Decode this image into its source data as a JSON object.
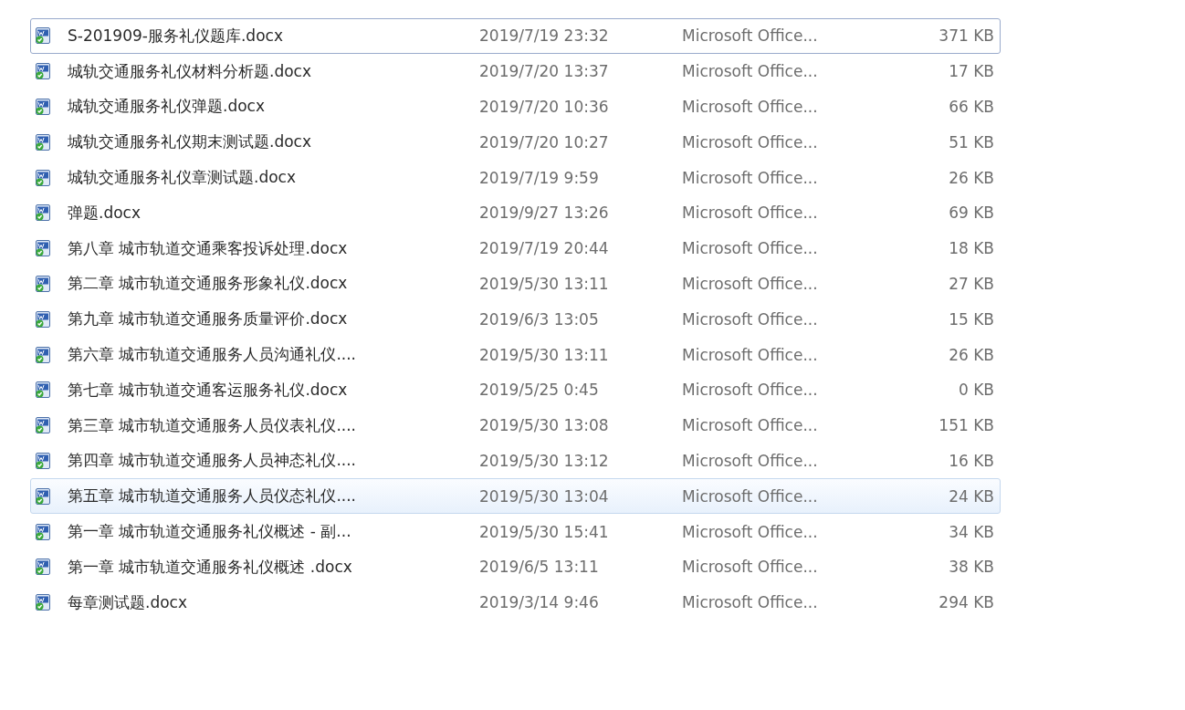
{
  "files": [
    {
      "name": "S-201909-服务礼仪题库.docx",
      "modified": "2019/7/19 23:32",
      "type": "Microsoft Office...",
      "size": "371 KB",
      "focused": true,
      "hovered": false
    },
    {
      "name": "城轨交通服务礼仪材料分析题.docx",
      "modified": "2019/7/20 13:37",
      "type": "Microsoft Office...",
      "size": "17 KB",
      "focused": false,
      "hovered": false
    },
    {
      "name": "城轨交通服务礼仪弹题.docx",
      "modified": "2019/7/20 10:36",
      "type": "Microsoft Office...",
      "size": "66 KB",
      "focused": false,
      "hovered": false
    },
    {
      "name": "城轨交通服务礼仪期末测试题.docx",
      "modified": "2019/7/20 10:27",
      "type": "Microsoft Office...",
      "size": "51 KB",
      "focused": false,
      "hovered": false
    },
    {
      "name": "城轨交通服务礼仪章测试题.docx",
      "modified": "2019/7/19 9:59",
      "type": "Microsoft Office...",
      "size": "26 KB",
      "focused": false,
      "hovered": false
    },
    {
      "name": "弹题.docx",
      "modified": "2019/9/27 13:26",
      "type": "Microsoft Office...",
      "size": "69 KB",
      "focused": false,
      "hovered": false
    },
    {
      "name": "第八章 城市轨道交通乘客投诉处理.docx",
      "modified": "2019/7/19 20:44",
      "type": "Microsoft Office...",
      "size": "18 KB",
      "focused": false,
      "hovered": false
    },
    {
      "name": "第二章 城市轨道交通服务形象礼仪.docx",
      "modified": "2019/5/30 13:11",
      "type": "Microsoft Office...",
      "size": "27 KB",
      "focused": false,
      "hovered": false
    },
    {
      "name": "第九章 城市轨道交通服务质量评价.docx",
      "modified": "2019/6/3 13:05",
      "type": "Microsoft Office...",
      "size": "15 KB",
      "focused": false,
      "hovered": false
    },
    {
      "name": "第六章 城市轨道交通服务人员沟通礼仪....",
      "modified": "2019/5/30 13:11",
      "type": "Microsoft Office...",
      "size": "26 KB",
      "focused": false,
      "hovered": false
    },
    {
      "name": "第七章 城市轨道交通客运服务礼仪.docx",
      "modified": "2019/5/25 0:45",
      "type": "Microsoft Office...",
      "size": "0 KB",
      "focused": false,
      "hovered": false
    },
    {
      "name": "第三章 城市轨道交通服务人员仪表礼仪....",
      "modified": "2019/5/30 13:08",
      "type": "Microsoft Office...",
      "size": "151 KB",
      "focused": false,
      "hovered": false
    },
    {
      "name": "第四章 城市轨道交通服务人员神态礼仪....",
      "modified": "2019/5/30 13:12",
      "type": "Microsoft Office...",
      "size": "16 KB",
      "focused": false,
      "hovered": false
    },
    {
      "name": "第五章 城市轨道交通服务人员仪态礼仪....",
      "modified": "2019/5/30 13:04",
      "type": "Microsoft Office...",
      "size": "24 KB",
      "focused": false,
      "hovered": true
    },
    {
      "name": "第一章 城市轨道交通服务礼仪概述  - 副...",
      "modified": "2019/5/30 15:41",
      "type": "Microsoft Office...",
      "size": "34 KB",
      "focused": false,
      "hovered": false
    },
    {
      "name": "第一章 城市轨道交通服务礼仪概述 .docx",
      "modified": "2019/6/5 13:11",
      "type": "Microsoft Office...",
      "size": "38 KB",
      "focused": false,
      "hovered": false
    },
    {
      "name": "每章测试题.docx",
      "modified": "2019/3/14 9:46",
      "type": "Microsoft Office...",
      "size": "294 KB",
      "focused": false,
      "hovered": false
    }
  ]
}
